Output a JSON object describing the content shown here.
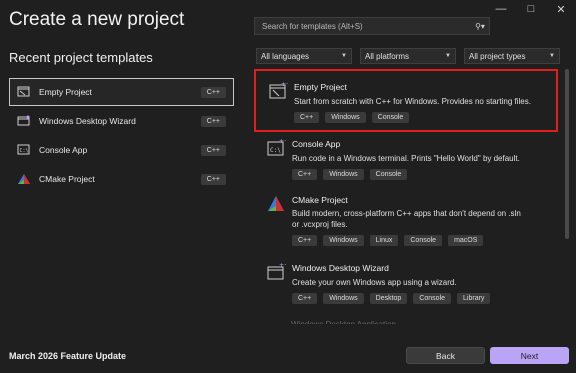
{
  "window": {
    "title": "Create a new project"
  },
  "recent": {
    "heading": "Recent project templates",
    "items": [
      {
        "label": "Empty Project",
        "tag": "C++",
        "icon": "empty-project-icon"
      },
      {
        "label": "Windows Desktop Wizard",
        "tag": "C++",
        "icon": "windows-desktop-wizard-icon"
      },
      {
        "label": "Console App",
        "tag": "C++",
        "icon": "console-app-icon"
      },
      {
        "label": "CMake Project",
        "tag": "C++",
        "icon": "cmake-icon"
      }
    ]
  },
  "search": {
    "placeholder": "Search for templates (Alt+S)"
  },
  "filters": {
    "language": "All languages",
    "platform": "All platforms",
    "project_type": "All project types"
  },
  "templates": [
    {
      "name": "Empty Project",
      "desc1": "Start from scratch with C++ for Windows. Provides no starting files.",
      "desc2": "",
      "tags": [
        "C++",
        "Windows",
        "Console"
      ]
    },
    {
      "name": "Console App",
      "desc1": "Run code in a Windows terminal. Prints \"Hello World\" by default.",
      "desc2": "",
      "tags": [
        "C++",
        "Windows",
        "Console"
      ]
    },
    {
      "name": "CMake Project",
      "desc1": "Build modern, cross-platform C++ apps that don't depend on .sln",
      "desc2": "or .vcxproj files.",
      "tags": [
        "C++",
        "Windows",
        "Linux",
        "Console",
        "macOS"
      ]
    },
    {
      "name": "Windows Desktop Wizard",
      "desc1": "Create your own Windows app using a wizard.",
      "desc2": "",
      "tags": [
        "C++",
        "Windows",
        "Desktop",
        "Console",
        "Library"
      ]
    }
  ],
  "faded_item": "Windows Desktop Application",
  "footer": {
    "version": "March 2026 Feature Update",
    "back": "Back",
    "next": "Next"
  },
  "colors": {
    "accent": "#b9a4f5",
    "selection_border": "#e01e1e",
    "background": "#1f1f1f"
  }
}
